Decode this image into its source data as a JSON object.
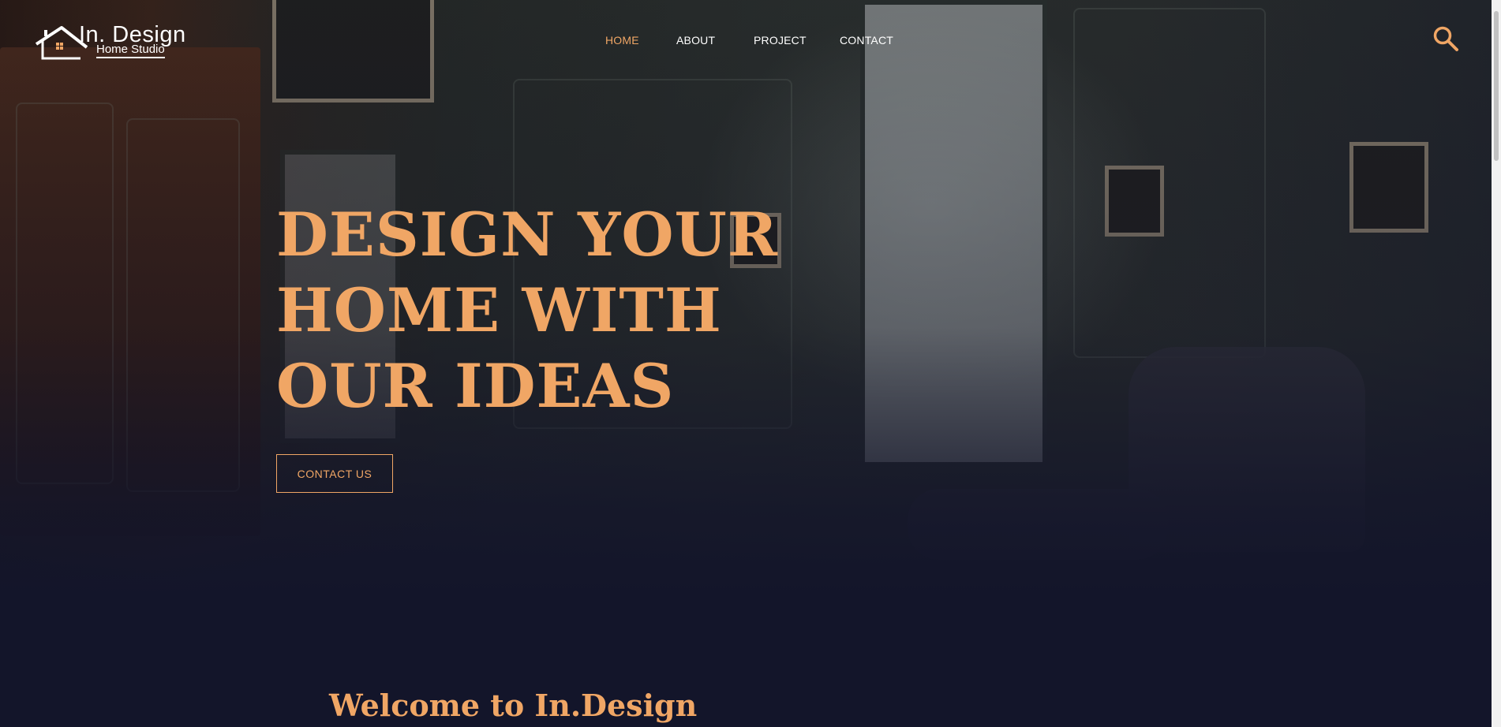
{
  "logo": {
    "title": "In. Design",
    "subtitle": "Home Studio",
    "icon": "house-logo-icon"
  },
  "nav": {
    "items": [
      {
        "label": "HOME",
        "active": true
      },
      {
        "label": "ABOUT",
        "active": false
      },
      {
        "label": "PROJECT",
        "active": false
      },
      {
        "label": "CONTACT",
        "active": false
      }
    ]
  },
  "search": {
    "icon": "search-icon"
  },
  "hero": {
    "title_lines": [
      "DESIGN YOUR",
      "HOME WITH",
      "OUR IDEAS"
    ],
    "button_label": "CONTACT US"
  },
  "welcome": {
    "heading": "Welcome to In.Design"
  },
  "colors": {
    "accent": "#f0a665",
    "background": "#13152a",
    "nav_text": "#ffffff"
  }
}
